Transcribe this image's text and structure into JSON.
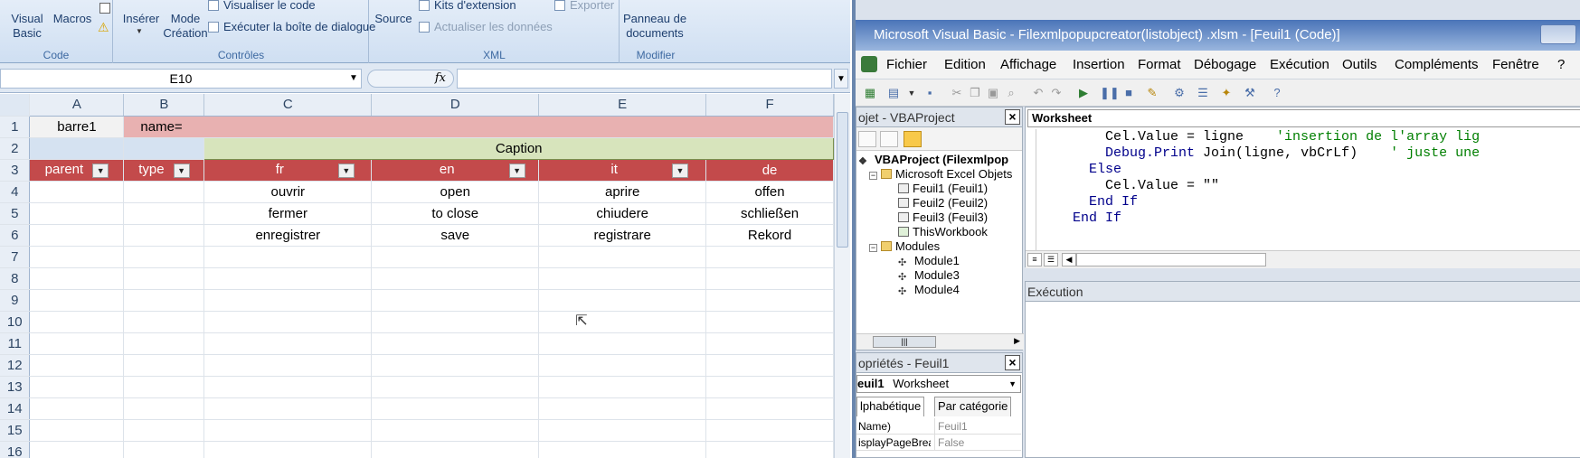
{
  "excel": {
    "ribbon": {
      "code_group": {
        "visual_basic": "Visual\nBasic",
        "macros": "Macros",
        "label": "Code"
      },
      "controles_group": {
        "inserer": "Insérer",
        "mode_creation": "Mode\nCréation",
        "visualiser_code": "Visualiser le code",
        "executer": "Exécuter la boîte de dialogue",
        "label": "Contrôles"
      },
      "xml_group": {
        "source": "Source",
        "kits": "Kits d'extension",
        "actualiser": "Actualiser les données",
        "exporter": "Exporter",
        "label": "XML"
      },
      "modifier_group": {
        "panneau": "Panneau de\ndocuments",
        "label": "Modifier"
      }
    },
    "formula_bar": {
      "name_box": "E10",
      "fx": "fx",
      "value": ""
    },
    "columns": [
      "A",
      "B",
      "C",
      "D",
      "E",
      "F"
    ],
    "rows": [
      1,
      2,
      3,
      4,
      5,
      6,
      7,
      8,
      9,
      10,
      11,
      12,
      13,
      14,
      15,
      16
    ],
    "cells": {
      "a1": "barre1",
      "b1": "name=",
      "c2": "Caption",
      "headers": [
        "parent",
        "type",
        "fr",
        "en",
        "it",
        "de"
      ],
      "data": [
        [
          "",
          "",
          "ouvrir",
          "open",
          "aprire",
          "offen"
        ],
        [
          "",
          "",
          "fermer",
          "to close",
          "chiudere",
          "schließen"
        ],
        [
          "",
          "",
          "enregistrer",
          "save",
          "registrare",
          "Rekord"
        ]
      ]
    }
  },
  "vbe": {
    "title": "Microsoft Visual Basic - Filexmlpopupcreator(listobject) .xlsm - [Feuil1 (Code)]",
    "menu": [
      "Fichier",
      "Edition",
      "Affichage",
      "Insertion",
      "Format",
      "Débogage",
      "Exécution",
      "Outils",
      "Compléments",
      "Fenêtre",
      "?"
    ],
    "project": {
      "title": "ojet - VBAProject",
      "root": "VBAProject (Filexmlpop",
      "folder_objects": "Microsoft Excel Objets",
      "objects": [
        "Feuil1 (Feuil1)",
        "Feuil2 (Feuil2)",
        "Feuil3 (Feuil3)",
        "ThisWorkbook"
      ],
      "folder_modules": "Modules",
      "modules": [
        "Module1",
        "Module3",
        "Module4"
      ]
    },
    "properties": {
      "title": "opriétés - Feuil1",
      "object": "euil1",
      "object_type": "Worksheet",
      "tab_alpha": "lphabétique",
      "tab_cat": "Par catégorie",
      "rows": [
        [
          "Name)",
          "Feuil1"
        ],
        [
          "isplayPageBrea",
          "False"
        ]
      ]
    },
    "code": {
      "object_combo": "Worksheet",
      "lines": [
        {
          "indent": "        ",
          "text": "Cel.Value = ligne    ",
          "comment": "'insertion de l'array lig"
        },
        {
          "indent": "        ",
          "kw": "Debug.Print",
          "text": " Join(ligne, vbCrLf)    ",
          "comment": "' juste une"
        },
        {
          "indent": "      ",
          "kw": "Else",
          "text": "",
          "comment": ""
        },
        {
          "indent": "        ",
          "text": "Cel.Value = \"\"",
          "comment": ""
        },
        {
          "indent": "      ",
          "kw": "End If",
          "text": "",
          "comment": ""
        },
        {
          "indent": "    ",
          "kw": "End If",
          "text": "",
          "comment": ""
        }
      ]
    },
    "execution": {
      "title": "Exécution"
    }
  },
  "colors": {
    "header_red": "#c34a4b",
    "caption_green": "#d7e4bc",
    "name_pink": "#e8b1b1",
    "vbe_title": "#4a74b8"
  }
}
